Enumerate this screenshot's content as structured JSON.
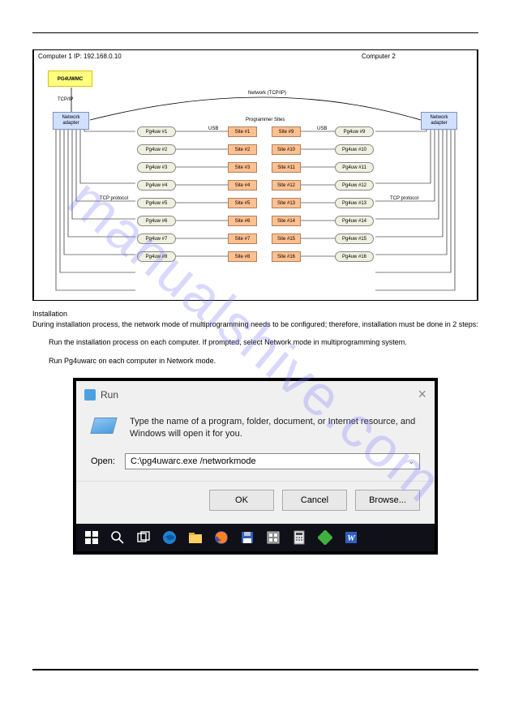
{
  "watermark": "manualshive.com",
  "diagram": {
    "computer1_label": "Computer 1    IP: 192.168.0.10",
    "computer2_label": "Computer 2",
    "pg4uwmc": "PG4UWMC",
    "netadapter": "Network\nadapter",
    "tcpip": "TCP/IP",
    "network_tcpip": "Network (TCP/IP)",
    "programmer_sites": "Programmer Sites",
    "usb": "USB",
    "tcp_protocol": "TCP protocol",
    "pg4uw_left": [
      "Pg4uw #1",
      "Pg4uw #2",
      "Pg4uw #3",
      "Pg4uw #4",
      "Pg4uw #5",
      "Pg4uw #6",
      "Pg4uw #7",
      "Pg4uw #8"
    ],
    "sites_left": [
      "Site #1",
      "Site #2",
      "Site #3",
      "Site #4",
      "Site #5",
      "Site #6",
      "Site #7",
      "Site #8"
    ],
    "sites_right": [
      "Site #9",
      "Site #10",
      "Site #11",
      "Site #12",
      "Site #13",
      "Site #14",
      "Site #15",
      "Site #16"
    ],
    "pg4uw_right": [
      "Pg4uw #9",
      "Pg4uw #10",
      "Pg4uw #11",
      "Pg4uw #12",
      "Pg4uw #13",
      "Pg4uw #14",
      "Pg4uw #15",
      "Pg4uw #16"
    ]
  },
  "text": {
    "p1": "Installation\nDuring installation process, the network mode of multiprogramming needs to be configured; therefore, installation must be done in 2 steps:",
    "p2": "Run the installation process on each computer. If prompted, select Network mode in multiprogramming system.",
    "p3": "Run Pg4uwarc on each computer in Network mode."
  },
  "run": {
    "title": "Run",
    "desc": "Type the name of a program, folder, document, or Internet resource, and Windows will open it for you.",
    "open_label": "Open:",
    "value": "C:\\pg4uwarc.exe /networkmode",
    "ok": "OK",
    "cancel": "Cancel",
    "browse": "Browse..."
  }
}
